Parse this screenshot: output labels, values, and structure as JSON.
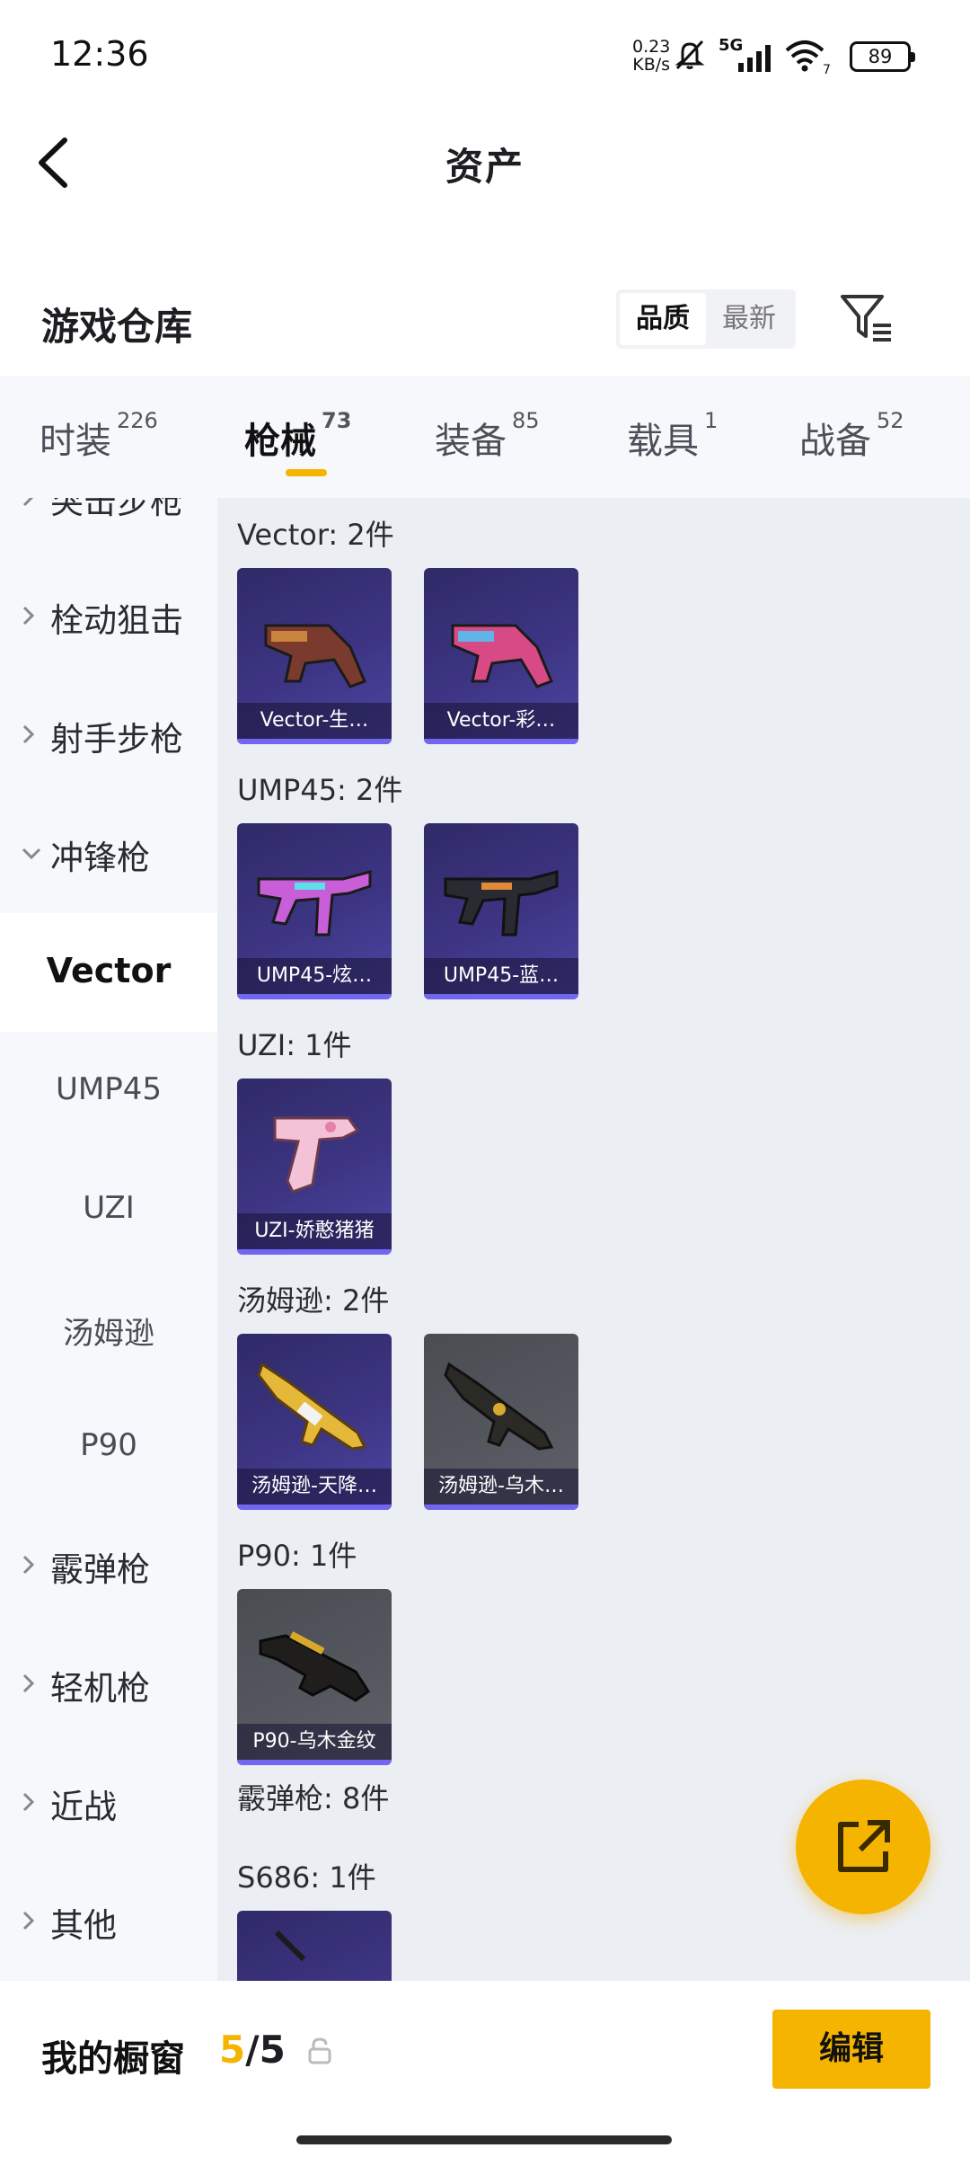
{
  "status_bar": {
    "time": "12:36",
    "net_speed_value": "0.23",
    "net_speed_unit": "KB/s",
    "network": "5G",
    "wifi_badge": "7",
    "battery": "89",
    "icons": [
      "mute-icon",
      "signal-icon",
      "wifi-icon",
      "battery-icon"
    ]
  },
  "header": {
    "title": "资产"
  },
  "section": {
    "title": "游戏仓库",
    "sort_options": [
      "品质",
      "最新"
    ],
    "sort_active": "品质"
  },
  "tabs": [
    {
      "label": "时装",
      "count": "226"
    },
    {
      "label": "枪械",
      "count": "73",
      "active": true
    },
    {
      "label": "装备",
      "count": "85"
    },
    {
      "label": "载具",
      "count": "1"
    },
    {
      "label": "战备",
      "count": "52"
    }
  ],
  "sidebar": {
    "categories": [
      {
        "label": "突击步枪",
        "expanded": false
      },
      {
        "label": "栓动狙击",
        "expanded": false
      },
      {
        "label": "射手步枪",
        "expanded": false
      },
      {
        "label": "冲锋枪",
        "expanded": true
      },
      {
        "label": "霰弹枪",
        "expanded": false
      },
      {
        "label": "轻机枪",
        "expanded": false
      },
      {
        "label": "近战",
        "expanded": false
      },
      {
        "label": "其他",
        "expanded": false
      }
    ],
    "subitems": [
      {
        "label": "Vector",
        "active": true
      },
      {
        "label": "UMP45"
      },
      {
        "label": "UZI"
      },
      {
        "label": "汤姆逊"
      },
      {
        "label": "P90"
      }
    ]
  },
  "groups": [
    {
      "title": "Vector: 2件",
      "items": [
        {
          "name": "Vector-生…",
          "rarity": "purple"
        },
        {
          "name": "Vector-彩…",
          "rarity": "purple"
        }
      ]
    },
    {
      "title": "UMP45: 2件",
      "items": [
        {
          "name": "UMP45-炫…",
          "rarity": "purple"
        },
        {
          "name": "UMP45-蓝…",
          "rarity": "purple"
        }
      ]
    },
    {
      "title": "UZI: 1件",
      "items": [
        {
          "name": "UZI-娇憨猪猪",
          "rarity": "purple"
        }
      ]
    },
    {
      "title": "汤姆逊: 2件",
      "items": [
        {
          "name": "汤姆逊-天降…",
          "rarity": "purple"
        },
        {
          "name": "汤姆逊-乌木…",
          "rarity": "gray"
        }
      ]
    },
    {
      "title": "P90: 1件",
      "items": [
        {
          "name": "P90-乌木金纹",
          "rarity": "gray"
        }
      ]
    }
  ],
  "category_summary": {
    "title": "霰弹枪: 8件"
  },
  "subgroup": {
    "title": "S686: 1件"
  },
  "bottom_bar": {
    "label": "我的橱窗",
    "count_current": "5",
    "count_separator": "/",
    "count_total": "5",
    "edit_label": "编辑"
  },
  "colors": {
    "accent": "#f5b400",
    "rarity_purple": "#3d3583",
    "rarity_gray": "#55585f",
    "rarity_bar": "#7265f0"
  }
}
